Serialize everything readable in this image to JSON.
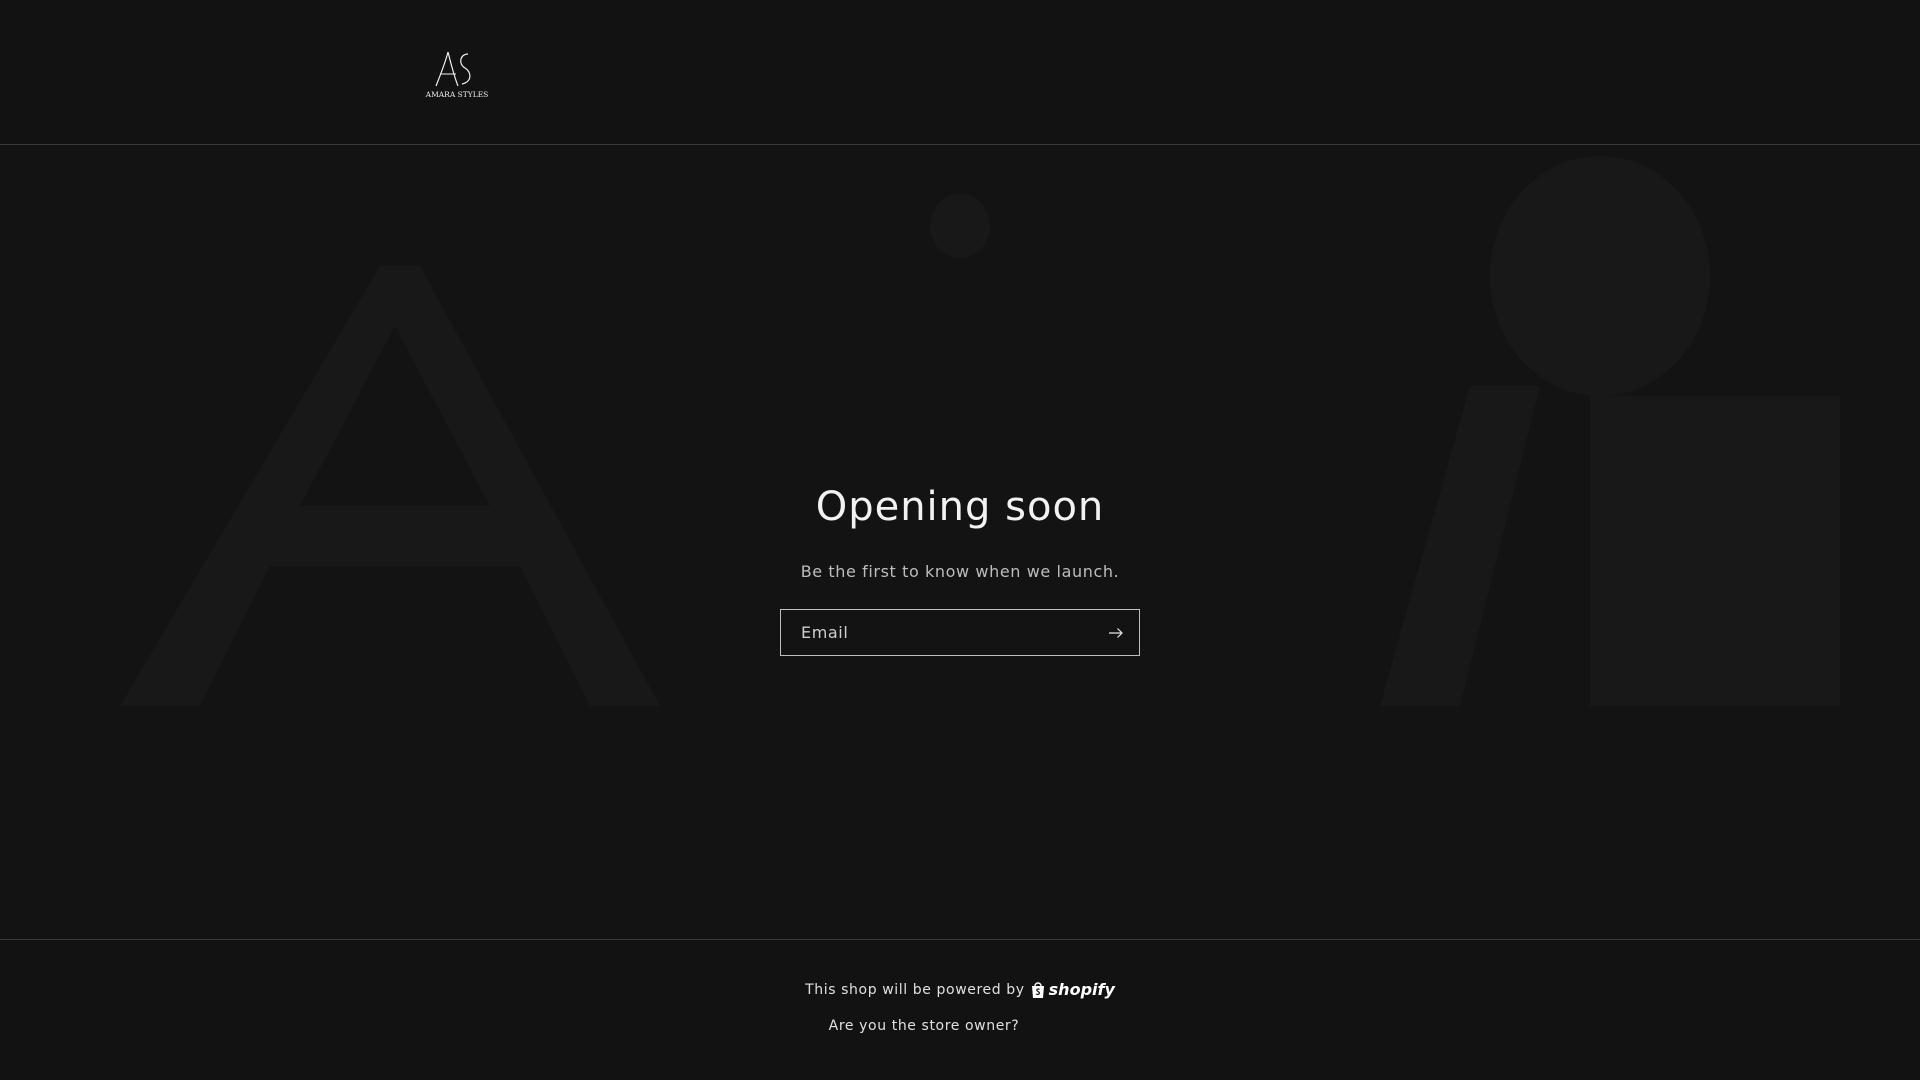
{
  "header": {
    "logo_text": "AMARA STYLES",
    "logo_monogram": "AS"
  },
  "hero": {
    "title": "Opening soon",
    "subtitle": "Be the first to know when we launch.",
    "email": {
      "placeholder": "Email",
      "value": ""
    },
    "submit_icon": "arrow-right-icon"
  },
  "footer": {
    "powered_text": "This shop will be powered by",
    "shopify_label": "shopify",
    "owner_link": "Are you the store owner?"
  },
  "colors": {
    "background": "#121212",
    "text": "#ffffff",
    "border": "#3a3a3a"
  }
}
